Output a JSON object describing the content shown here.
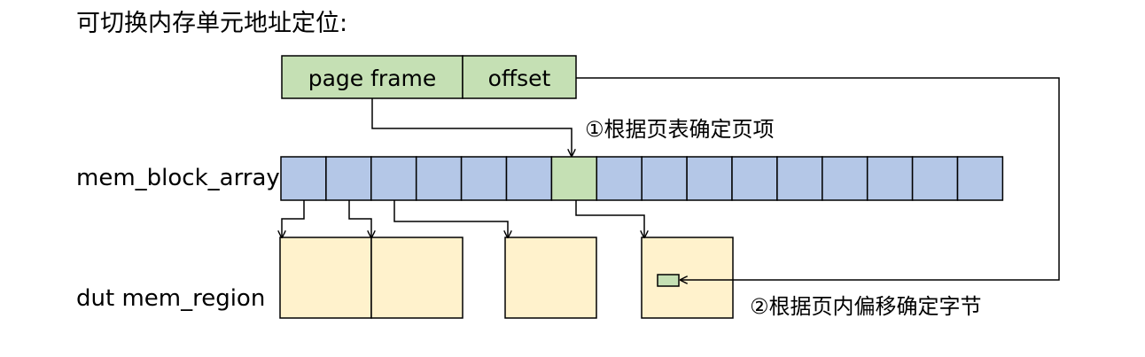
{
  "title": "可切换内存单元地址定位:",
  "address": {
    "fields": [
      "page frame",
      "offset"
    ],
    "fill": "#c5e0b4"
  },
  "labels": {
    "mem_block_array": "mem_block_array",
    "mem_region": "dut mem_region"
  },
  "annotations": {
    "step1": "①根据页表确定页项",
    "step2": "②根据页内偏移确定字节"
  },
  "mem_block_array": {
    "cell_count": 16,
    "selected_index": 6,
    "cell_fill": "#b4c7e7",
    "selected_fill": "#c5e0b4"
  },
  "mem_region": {
    "fill": "#fff2cc",
    "byte_fill": "#c5e0b4"
  },
  "stroke": "#000000"
}
